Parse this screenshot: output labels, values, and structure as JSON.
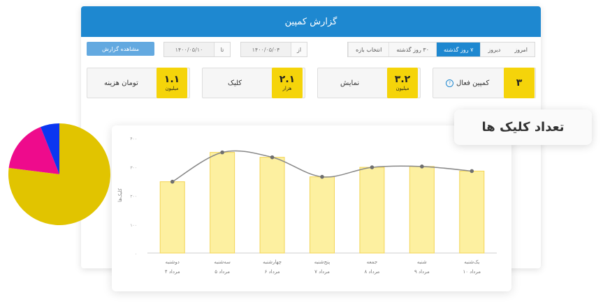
{
  "panel": {
    "title": "گزارش کمپین",
    "tabs": [
      {
        "label": "امروز"
      },
      {
        "label": "دیروز"
      },
      {
        "label": "۷ روز گذشته",
        "active": true
      },
      {
        "label": "۳۰ روز گذشته"
      },
      {
        "label": "انتخاب بازه"
      }
    ],
    "from": {
      "label": "از",
      "value": "۱۴۰۰/۰۵/۰۴"
    },
    "to": {
      "label": "تا",
      "value": "۱۴۰۰/۰۵/۱۰"
    },
    "view_button": "مشاهده گزارش"
  },
  "cards": [
    {
      "title": "کمپین فعال",
      "value": "۳",
      "unit": "",
      "info": true
    },
    {
      "title": "نمایش",
      "value": "۳.۲",
      "unit": "میلیون"
    },
    {
      "title": "کلیک",
      "value": "۲.۱",
      "unit": "هزار"
    },
    {
      "title": "تومان هزینه",
      "value": "۱.۱",
      "unit": "میلیون"
    }
  ],
  "callout": "تعداد کلیک ها",
  "colors": {
    "accent": "#1e88d0",
    "badge": "#f5d40a",
    "bar": "#fdf0a0",
    "bar_border": "#f3d555",
    "line": "#888888"
  },
  "icons": {
    "info": "info-icon"
  },
  "chart_data": {
    "type": "bar",
    "categories": [
      "دوشنبه",
      "سه‌شنبه",
      "چهارشنبه",
      "پنج‌شنبه",
      "جمعه",
      "شنبه",
      "یک‌شنبه"
    ],
    "subcategories": [
      "۴ مرداد",
      "۵ مرداد",
      "۶ مرداد",
      "۷ مرداد",
      "۸ مرداد",
      "۹ مرداد",
      "۱۰ مرداد"
    ],
    "values": [
      248,
      350,
      333,
      265,
      298,
      301,
      285
    ],
    "line_values": [
      248,
      350,
      333,
      265,
      298,
      301,
      285
    ],
    "ylabel": "کلیک‌ها",
    "yticks": [
      "۰",
      "۱۰۰",
      "۲۰۰",
      "۳۰۰",
      "۴۰۰"
    ],
    "ylim": [
      0,
      400
    ],
    "grid": false
  },
  "pie_data": {
    "type": "pie",
    "values": [
      77,
      17,
      6
    ],
    "colors": [
      "#e1c400",
      "#ee0b8c",
      "#0b36f0"
    ]
  }
}
